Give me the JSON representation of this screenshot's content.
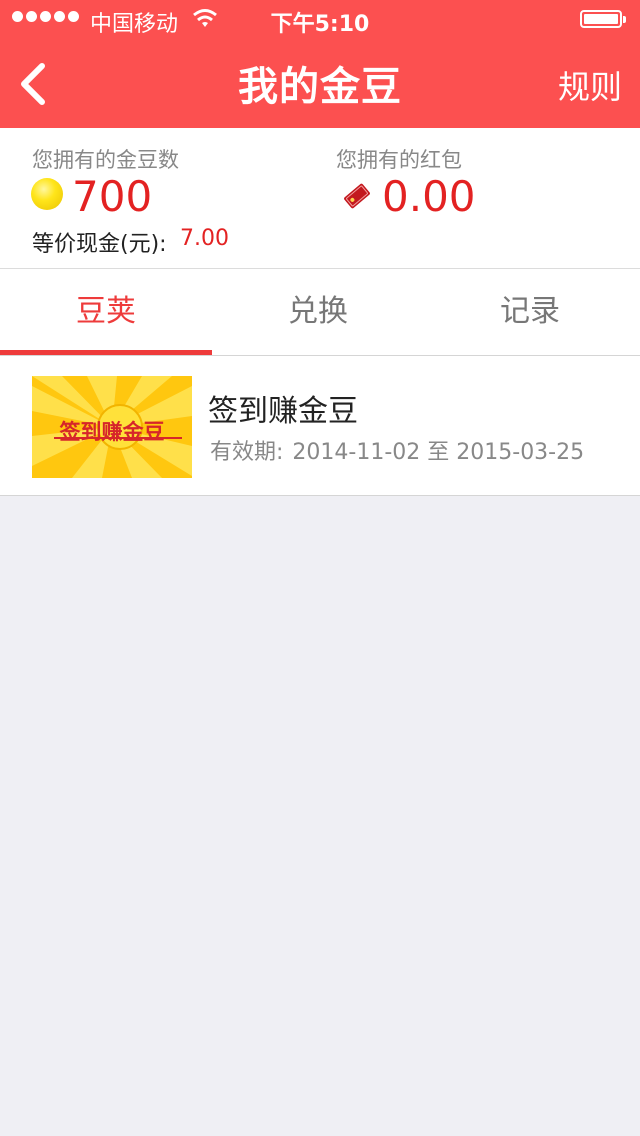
{
  "status_bar": {
    "carrier": "中国移动",
    "time": "下午5:10"
  },
  "nav": {
    "title": "我的金豆",
    "right_label": "规则"
  },
  "summary": {
    "gold_label": "您拥有的金豆数",
    "gold_value": "700",
    "cash_label": "等价现金(元):",
    "cash_value": "7.00",
    "red_label": "您拥有的红包",
    "red_value": "0.00"
  },
  "tabs": [
    {
      "label": "豆荚",
      "active": true
    },
    {
      "label": "兑换",
      "active": false
    },
    {
      "label": "记录",
      "active": false
    }
  ],
  "items": [
    {
      "image_text": "签到赚金豆",
      "title": "签到赚金豆",
      "validity_label": "有效期:",
      "validity_value": "2014-11-02 至 2015-03-25"
    }
  ],
  "colors": {
    "header": "#fc5050",
    "accent_red": "#e32222",
    "tab_active": "#ee3b3b"
  }
}
